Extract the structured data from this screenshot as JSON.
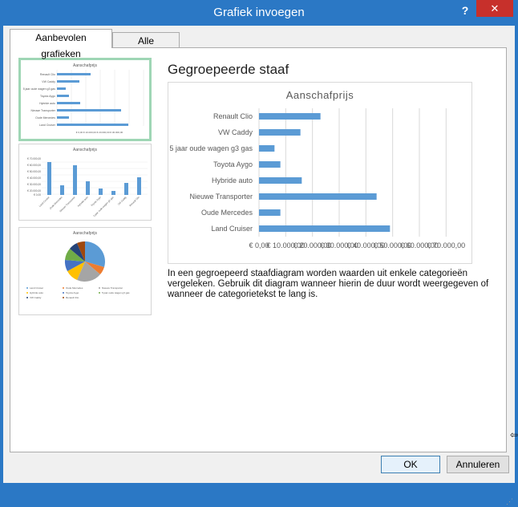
{
  "window": {
    "title": "Grafiek invoegen",
    "help": "?",
    "close": "✕"
  },
  "tabs": [
    {
      "label": "Aanbevolen grafieken",
      "active": true
    },
    {
      "label": "Alle grafieken",
      "active": false
    }
  ],
  "thumbnails": [
    {
      "title": "Aanschafprijs",
      "type": "bar",
      "selected": true
    },
    {
      "title": "Aanschafprijs",
      "type": "column",
      "selected": false
    },
    {
      "title": "Aanschafprijs",
      "type": "pie",
      "selected": false
    }
  ],
  "preview": {
    "heading": "Gegroepeerde staaf",
    "description": "In een gegroepeerd staafdiagram worden waarden uit enkele categorieën vergeleken. Gebruik dit diagram wanneer hierin de duur wordt weergegeven of wanneer de categorietekst te lang is."
  },
  "chart_data": {
    "type": "bar",
    "title": "Aanschafprijs",
    "categories": [
      "Renault Clio",
      "VW Caddy",
      "5 jaar oude wagen g3 gas",
      "Toyota Aygo",
      "Hybride auto",
      "Nieuwe Transporter",
      "Oude Mercedes",
      "Land Cruiser"
    ],
    "values": [
      23000,
      15500,
      5800,
      8000,
      16000,
      44000,
      8000,
      49000
    ],
    "tick_labels": [
      "€ 0,00",
      "€ 10.000,00",
      "€ 20.000,00",
      "€ 30.000,00",
      "€ 40.000,00",
      "€ 50.000,00",
      "€ 60.000,00",
      "€ 70.000,00"
    ],
    "xlim": [
      0,
      60000
    ],
    "grid": true,
    "bar_color": "#5b9bd5"
  },
  "buttons": {
    "ok": "OK",
    "cancel": "Annuleren"
  },
  "colors": {
    "titlebar": "#2b78c5",
    "close": "#c7302b",
    "selected_border": "#9fd6b5"
  }
}
